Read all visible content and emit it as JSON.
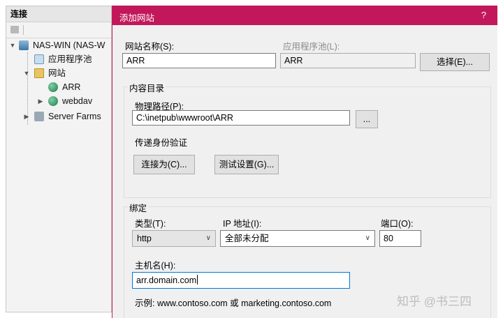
{
  "connections": {
    "title": "连接",
    "tree": [
      {
        "label": "NAS-WIN (NAS-W",
        "icon": "server-icon"
      },
      {
        "label": "应用程序池",
        "icon": "app-pool-icon"
      },
      {
        "label": "网站",
        "icon": "folder-icon"
      },
      {
        "label": "ARR",
        "icon": "globe-icon"
      },
      {
        "label": "webdav",
        "icon": "globe-icon"
      },
      {
        "label": "Server Farms",
        "icon": "server-farm-icon"
      }
    ]
  },
  "dialog": {
    "title": "添加网站",
    "help": "?",
    "site_name_label": "网站名称(S):",
    "site_name_value": "ARR",
    "app_pool_label": "应用程序池(L):",
    "app_pool_value": "ARR",
    "select_button": "选择(E)...",
    "content_group": "内容目录",
    "physical_path_label": "物理路径(P):",
    "physical_path_value": "C:\\inetpub\\wwwroot\\ARR",
    "browse_button": "...",
    "pass_through_label": "传递身份验证",
    "connect_as_button": "连接为(C)...",
    "test_settings_button": "测试设置(G)...",
    "binding_group": "绑定",
    "type_label": "类型(T):",
    "type_value": "http",
    "ip_label": "IP 地址(I):",
    "ip_value": "全部未分配",
    "port_label": "端口(O):",
    "port_value": "80",
    "host_label": "主机名(H):",
    "host_value": "arr.domain.com",
    "example_text": "示例: www.contoso.com 或 marketing.contoso.com"
  },
  "watermark": "知乎 @书三四",
  "colors": {
    "titlebar": "#c2185b",
    "focus_border": "#0078d7"
  }
}
